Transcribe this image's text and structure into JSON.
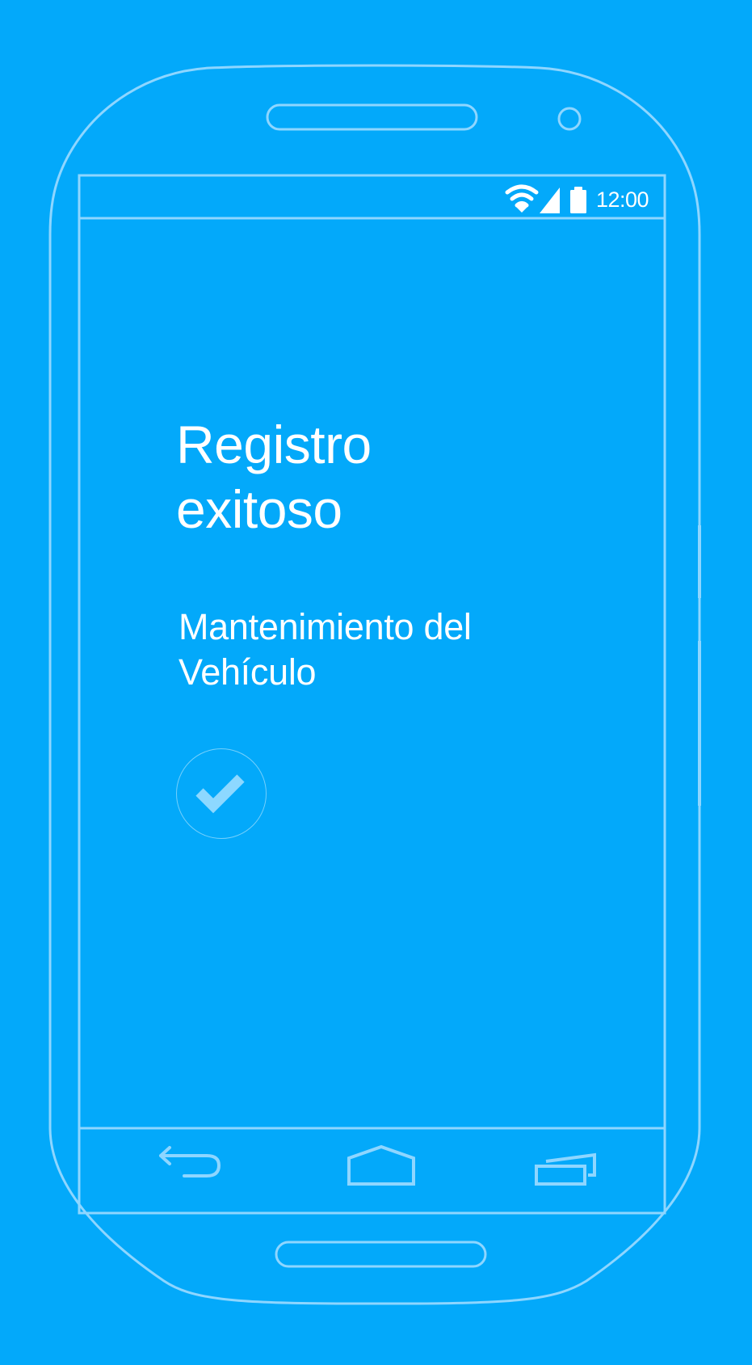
{
  "status_bar": {
    "time": "12:00",
    "icons": [
      "wifi-icon",
      "signal-icon",
      "battery-icon"
    ]
  },
  "screen": {
    "title_line1": "Registro",
    "title_line2": "exitoso",
    "subtitle_line1": "Mantenimiento del",
    "subtitle_line2": "Vehículo",
    "confirm_icon": "checkmark-icon"
  },
  "navigation": {
    "buttons": [
      "back-icon",
      "home-icon",
      "recent-apps-icon"
    ]
  },
  "colors": {
    "background": "#03A9FA",
    "outline": "#8ED6FF",
    "text": "#FFFFFF",
    "check": "#8DD8FF"
  }
}
